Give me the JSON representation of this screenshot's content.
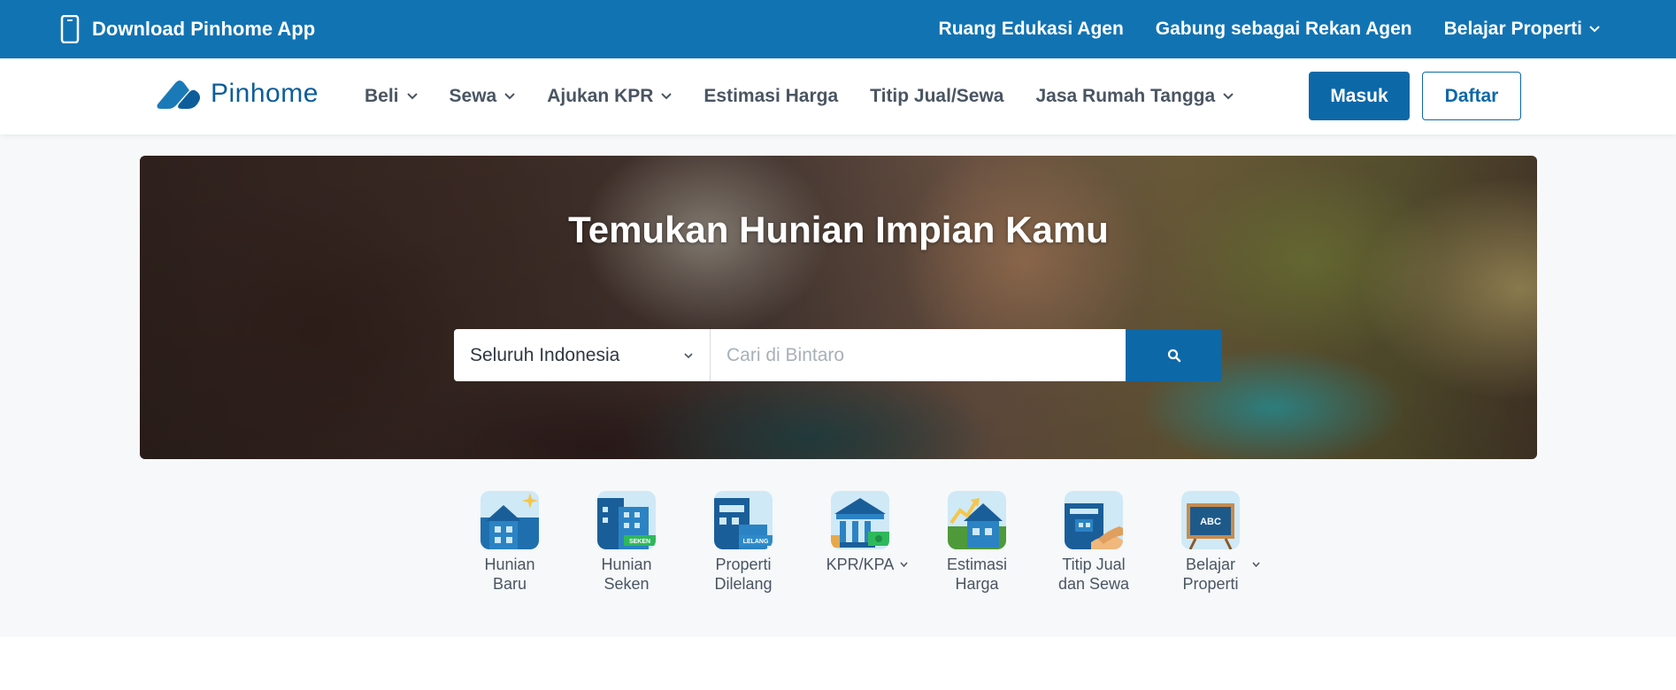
{
  "topbar": {
    "download_app": "Download Pinhome App",
    "links": [
      "Ruang Edukasi Agen",
      "Gabung sebagai Rekan Agen",
      "Belajar Properti"
    ]
  },
  "navbar": {
    "logo": "Pinhome",
    "menu": [
      "Beli",
      "Sewa",
      "Ajukan KPR",
      "Estimasi Harga",
      "Titip Jual/Sewa",
      "Jasa Rumah Tangga"
    ],
    "masuk": "Masuk",
    "daftar": "Daftar"
  },
  "hero": {
    "title": "Temukan Hunian Impian Kamu",
    "region": "Seluruh Indonesia",
    "search_placeholder": "Cari di Bintaro"
  },
  "categories": [
    {
      "label": "Hunian Baru",
      "icon": "new-home-icon"
    },
    {
      "label": "Hunian Seken",
      "icon": "used-home-icon",
      "badge": "SEKEN"
    },
    {
      "label": "Properti Dilelang",
      "icon": "auction-property-icon",
      "badge": "LELANG"
    },
    {
      "label": "KPR/KPA",
      "icon": "bank-icon"
    },
    {
      "label": "Estimasi Harga",
      "icon": "price-estimate-icon"
    },
    {
      "label": "Titip Jual dan Sewa",
      "icon": "consign-icon"
    },
    {
      "label": "Belajar Properti",
      "icon": "learn-board-icon",
      "badge": "ABC"
    }
  ],
  "colors": {
    "brand_blue": "#1273b3",
    "button_blue": "#0d68a8",
    "text_gray": "#4a5562"
  }
}
